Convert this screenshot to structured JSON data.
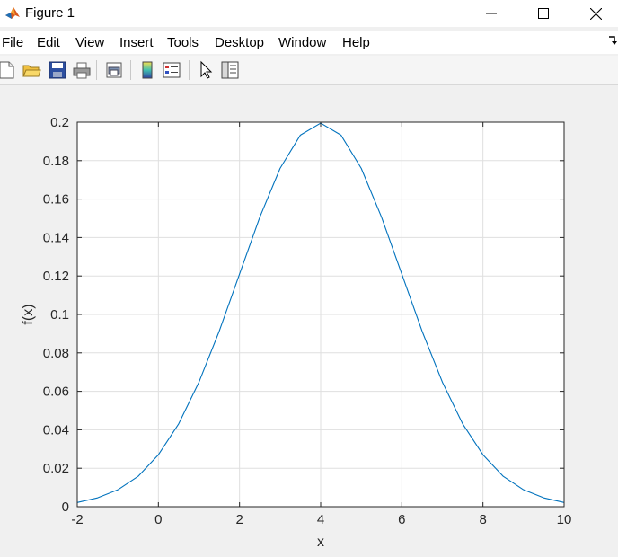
{
  "window": {
    "title": "Figure 1"
  },
  "menu": {
    "items": [
      "File",
      "Edit",
      "View",
      "Insert",
      "Tools",
      "Desktop",
      "Window",
      "Help"
    ]
  },
  "toolbar": {
    "buttons": [
      {
        "name": "new-figure-icon"
      },
      {
        "name": "open-file-icon"
      },
      {
        "name": "save-icon"
      },
      {
        "name": "print-icon"
      },
      {
        "name": "print-preview-icon"
      },
      {
        "name": "insert-colorbar-icon"
      },
      {
        "name": "insert-legend-icon"
      },
      {
        "name": "edit-plot-pointer-icon"
      },
      {
        "name": "property-inspector-icon"
      }
    ]
  },
  "chart_data": {
    "type": "line",
    "title": "",
    "xlabel": "x",
    "ylabel": "f(x)",
    "xlim": [
      -2,
      10
    ],
    "ylim": [
      0,
      0.2
    ],
    "xticks": [
      -2,
      0,
      2,
      4,
      6,
      8,
      10
    ],
    "yticks": [
      0,
      0.02,
      0.04,
      0.06,
      0.08,
      0.1,
      0.12,
      0.14,
      0.16,
      0.18,
      0.2
    ],
    "grid": true,
    "series": [
      {
        "color": "#0072bd",
        "x": [
          -2,
          -1.5,
          -1,
          -0.5,
          0,
          0.5,
          1,
          1.5,
          2,
          2.5,
          3,
          3.5,
          4,
          4.5,
          5,
          5.5,
          6,
          6.5,
          7,
          7.5,
          8,
          8.5,
          9,
          9.5,
          10
        ],
        "y": [
          0.0022,
          0.0046,
          0.0088,
          0.0158,
          0.027,
          0.0431,
          0.0648,
          0.0913,
          0.121,
          0.1506,
          0.176,
          0.1933,
          0.1995,
          0.1933,
          0.176,
          0.1506,
          0.121,
          0.0913,
          0.0648,
          0.0431,
          0.027,
          0.0158,
          0.0088,
          0.0046,
          0.0022
        ]
      }
    ]
  }
}
